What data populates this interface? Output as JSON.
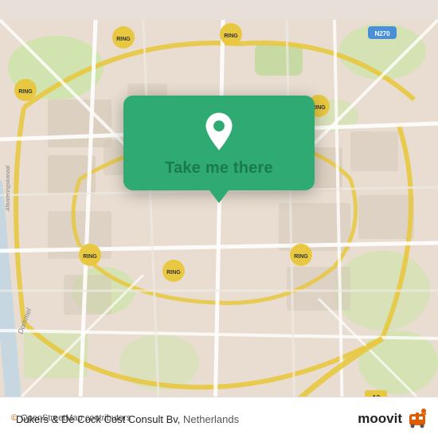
{
  "map": {
    "attribution": "© OpenStreetMap contributors",
    "background_color": "#e8ddd0"
  },
  "popup": {
    "button_label": "Take me there",
    "pin_color": "#ffffff"
  },
  "bottom_bar": {
    "location_name": "Dukers & De Cock Cost Consult Bv,",
    "country": "Netherlands",
    "osm_credit": "© OpenStreetMap contributors",
    "moovit_label": "moovit"
  }
}
